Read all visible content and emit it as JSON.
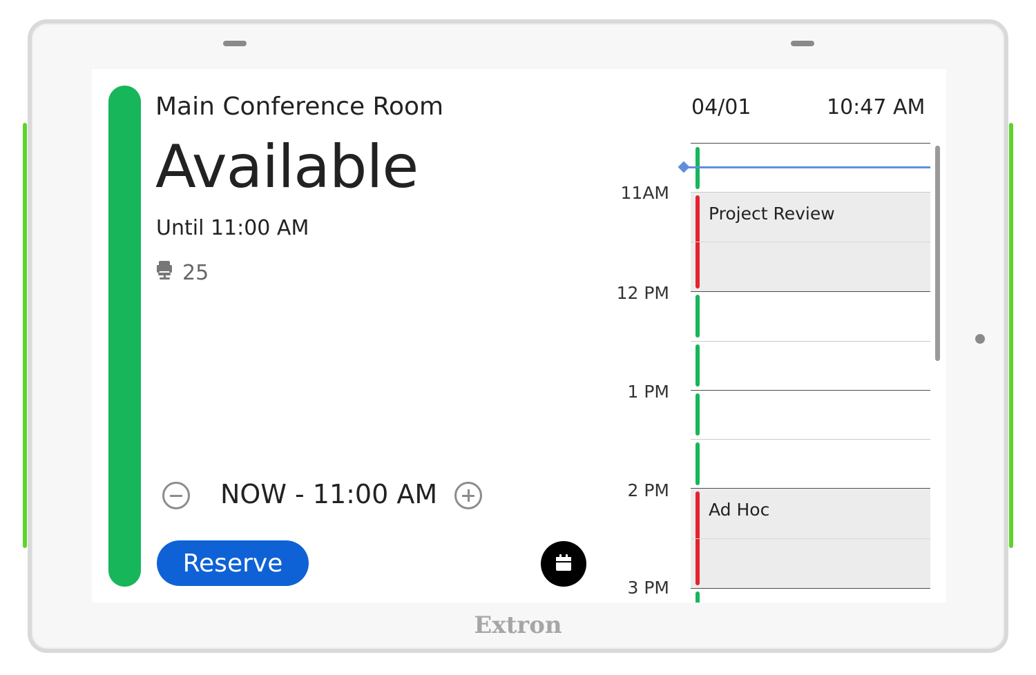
{
  "device": {
    "brand": "Extron",
    "accent_color": "#5ed32c"
  },
  "room": {
    "name": "Main Conference Room",
    "status": "Available",
    "status_color": "#17b65a",
    "until": "Until 11:00 AM",
    "capacity": "25",
    "capacity_icon": "chair-icon"
  },
  "header": {
    "date": "04/01",
    "time": "10:47 AM"
  },
  "reservation": {
    "decrease_icon": "minus-circle-icon",
    "duration": "NOW - 11:00 AM",
    "increase_icon": "plus-circle-icon",
    "reserve_label": "Reserve",
    "reserve_color": "#0f62d6",
    "calendar_icon": "calendar-icon"
  },
  "schedule": {
    "time_labels": [
      "11AM",
      "12 PM",
      "1 PM",
      "2 PM",
      "3 PM"
    ],
    "events": [
      {
        "title": "Project Review",
        "status_color": "#e4232e"
      },
      {
        "title": "Ad Hoc",
        "status_color": "#e4232e"
      }
    ],
    "current_time_color": "#5f8fdb"
  }
}
